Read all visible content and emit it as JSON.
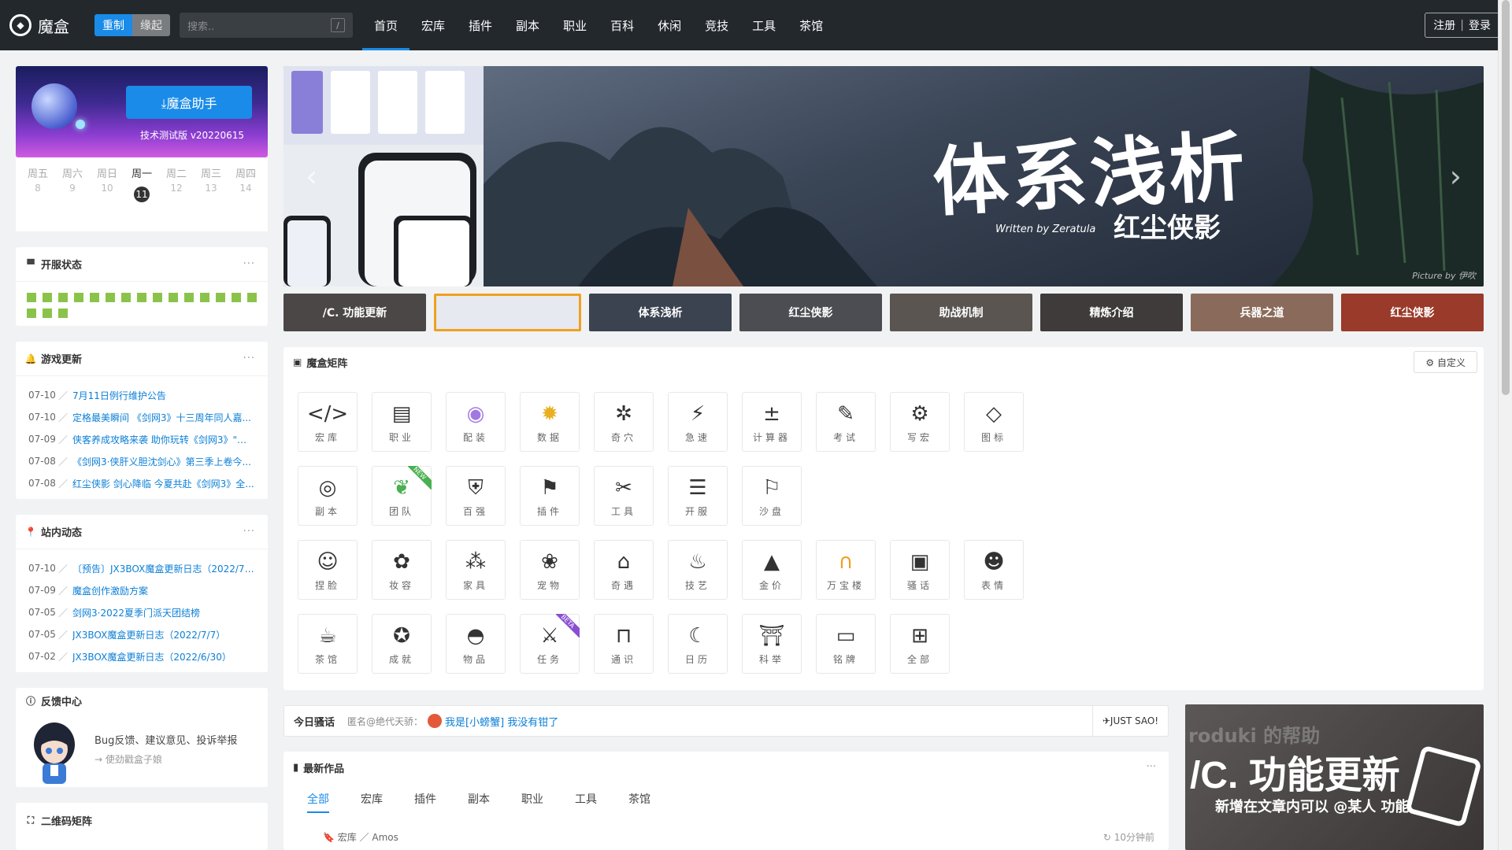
{
  "header": {
    "logo_text": "魔盒",
    "toggle": [
      "重制",
      "缘起"
    ],
    "search_placeholder": "搜索..",
    "search_key": "/",
    "nav": [
      "首页",
      "宏库",
      "插件",
      "副本",
      "职业",
      "百科",
      "休闲",
      "竞技",
      "工具",
      "茶馆"
    ],
    "nav_active": "首页",
    "register": "注册",
    "login": "登录"
  },
  "promo": {
    "button": "⤓魔盒助手",
    "version": "技术测试版 v20220615"
  },
  "week": [
    {
      "name": "周五",
      "num": "8"
    },
    {
      "name": "周六",
      "num": "9"
    },
    {
      "name": "周日",
      "num": "10"
    },
    {
      "name": "周一",
      "num": "11"
    },
    {
      "name": "周二",
      "num": "12"
    },
    {
      "name": "周三",
      "num": "13"
    },
    {
      "name": "周四",
      "num": "14"
    }
  ],
  "server_status": {
    "title": "开服状态",
    "count": 18,
    "color": "#8bc34a"
  },
  "game_updates": {
    "title": "游戏更新",
    "items": [
      {
        "date": "07-10",
        "text": "7月11日例行维护公告"
      },
      {
        "date": "07-10",
        "text": "定格最美瞬间 《剑网3》十三周年同人嘉..."
      },
      {
        "date": "07-09",
        "text": "侠客养成攻略来袭 助你玩转《剑网3》\"红..."
      },
      {
        "date": "07-08",
        "text": "《剑网3·侠肝义胆沈剑心》第三季上卷今..."
      },
      {
        "date": "07-08",
        "text": "红尘侠影 剑心降临 今夏共赴《剑网3》全..."
      }
    ]
  },
  "site_news": {
    "title": "站内动态",
    "items": [
      {
        "date": "07-10",
        "text": "〔预告〕JX3BOX魔盒更新日志（2022/7/..."
      },
      {
        "date": "07-09",
        "text": "魔盒创作激励方案"
      },
      {
        "date": "07-05",
        "text": "剑网3·2022夏季门派天团结榜"
      },
      {
        "date": "07-05",
        "text": "JX3BOX魔盒更新日志（2022/7/7）"
      },
      {
        "date": "07-02",
        "text": "JX3BOX魔盒更新日志（2022/6/30）"
      }
    ]
  },
  "feedback": {
    "title": "反馈中心",
    "line1": "Bug反馈、建议意见、投诉举报",
    "line2": "→ 使劲戳盒子娘"
  },
  "qrcode": {
    "title": "二维码矩阵"
  },
  "banner": {
    "title": "体系浅析",
    "subtitle": "红尘侠影",
    "written_by": "Written by Zeratula",
    "picture_by": "Picture by 伊吹",
    "arrow_left": "‹",
    "arrow_right": "›"
  },
  "thumbnails": [
    {
      "label": "/C. 功能更新",
      "color": "#4a4746"
    },
    {
      "label": "",
      "color": "#e6e9ef"
    },
    {
      "label": "体系浅析",
      "color": "#3b4350"
    },
    {
      "label": "红尘侠影",
      "color": "#4b4d52"
    },
    {
      "label": "助战机制",
      "color": "#5a5550"
    },
    {
      "label": "精炼介绍",
      "color": "#3e3b3a"
    },
    {
      "label": "兵器之道",
      "color": "#8a6a5a"
    },
    {
      "label": "红尘侠影",
      "color": "#9a3a2a"
    }
  ],
  "matrix": {
    "title": "魔盒矩阵",
    "customize": "⚙ 自定义",
    "tiles": [
      {
        "label": "宏库",
        "glyph": "</>",
        "color": "#333"
      },
      {
        "label": "职业",
        "glyph": "▤",
        "color": "#333"
      },
      {
        "label": "配装",
        "glyph": "◉",
        "color": "#a07ae0"
      },
      {
        "label": "数据",
        "glyph": "✹",
        "color": "#e8b020"
      },
      {
        "label": "奇穴",
        "glyph": "✲",
        "color": "#333"
      },
      {
        "label": "急速",
        "glyph": "⚡",
        "color": "#333"
      },
      {
        "label": "计算器",
        "glyph": "±",
        "color": "#333"
      },
      {
        "label": "考试",
        "glyph": "✎",
        "color": "#333"
      },
      {
        "label": "写宏",
        "glyph": "⚙",
        "color": "#333"
      },
      {
        "label": "图标",
        "glyph": "◇",
        "color": "#333"
      },
      {
        "label": "副本",
        "glyph": "◎",
        "color": "#333"
      },
      {
        "label": "团队",
        "glyph": "❦",
        "color": "#4ab050",
        "badge": "NEW",
        "badge_color": "#4ab050"
      },
      {
        "label": "百强",
        "glyph": "⛨",
        "color": "#333"
      },
      {
        "label": "插件",
        "glyph": "⚑",
        "color": "#333"
      },
      {
        "label": "工具",
        "glyph": "✂",
        "color": "#333"
      },
      {
        "label": "开服",
        "glyph": "☰",
        "color": "#333"
      },
      {
        "label": "沙盘",
        "glyph": "⚐",
        "color": "#333"
      },
      {
        "label": "捏脸",
        "glyph": "☺",
        "color": "#333"
      },
      {
        "label": "妆容",
        "glyph": "✿",
        "color": "#333"
      },
      {
        "label": "家具",
        "glyph": "⁂",
        "color": "#333"
      },
      {
        "label": "宠物",
        "glyph": "❀",
        "color": "#333"
      },
      {
        "label": "奇遇",
        "glyph": "⌂",
        "color": "#333"
      },
      {
        "label": "技艺",
        "glyph": "♨",
        "color": "#333"
      },
      {
        "label": "金价",
        "glyph": "▲",
        "color": "#333"
      },
      {
        "label": "万宝楼",
        "glyph": "∩",
        "color": "#f0a020"
      },
      {
        "label": "骚话",
        "glyph": "▣",
        "color": "#333"
      },
      {
        "label": "表情",
        "glyph": "☻",
        "color": "#333"
      },
      {
        "label": "茶馆",
        "glyph": "☕",
        "color": "#333"
      },
      {
        "label": "成就",
        "glyph": "✪",
        "color": "#333"
      },
      {
        "label": "物品",
        "glyph": "◓",
        "color": "#333"
      },
      {
        "label": "任务",
        "glyph": "⚔",
        "color": "#333",
        "badge": "BETA",
        "badge_color": "#8a4fd0"
      },
      {
        "label": "通识",
        "glyph": "⊓",
        "color": "#333"
      },
      {
        "label": "日历",
        "glyph": "☾",
        "color": "#333"
      },
      {
        "label": "科举",
        "glyph": "⛩",
        "color": "#333"
      },
      {
        "label": "铭牌",
        "glyph": "▭",
        "color": "#333"
      },
      {
        "label": "全部",
        "glyph": "⊞",
        "color": "#333"
      }
    ]
  },
  "saohua": {
    "title": "今日骚话",
    "who": "匿名@绝代天骄：",
    "message": "我是[小螃蟹] 我没有钳了",
    "button": "✈JUST SAO!"
  },
  "latest_works": {
    "title": "最新作品",
    "tabs": [
      "全部",
      "宏库",
      "插件",
      "副本",
      "职业",
      "工具",
      "茶馆"
    ],
    "active_tab": "全部",
    "row": {
      "category": "🔖 宏库 ／ Amos",
      "time": "↻ 10分钟前"
    }
  },
  "ad": {
    "headline": "/C. 功能更新",
    "subline": "新增在文章内可以 @某人 功能",
    "watermark": "roduki 的帮助"
  }
}
